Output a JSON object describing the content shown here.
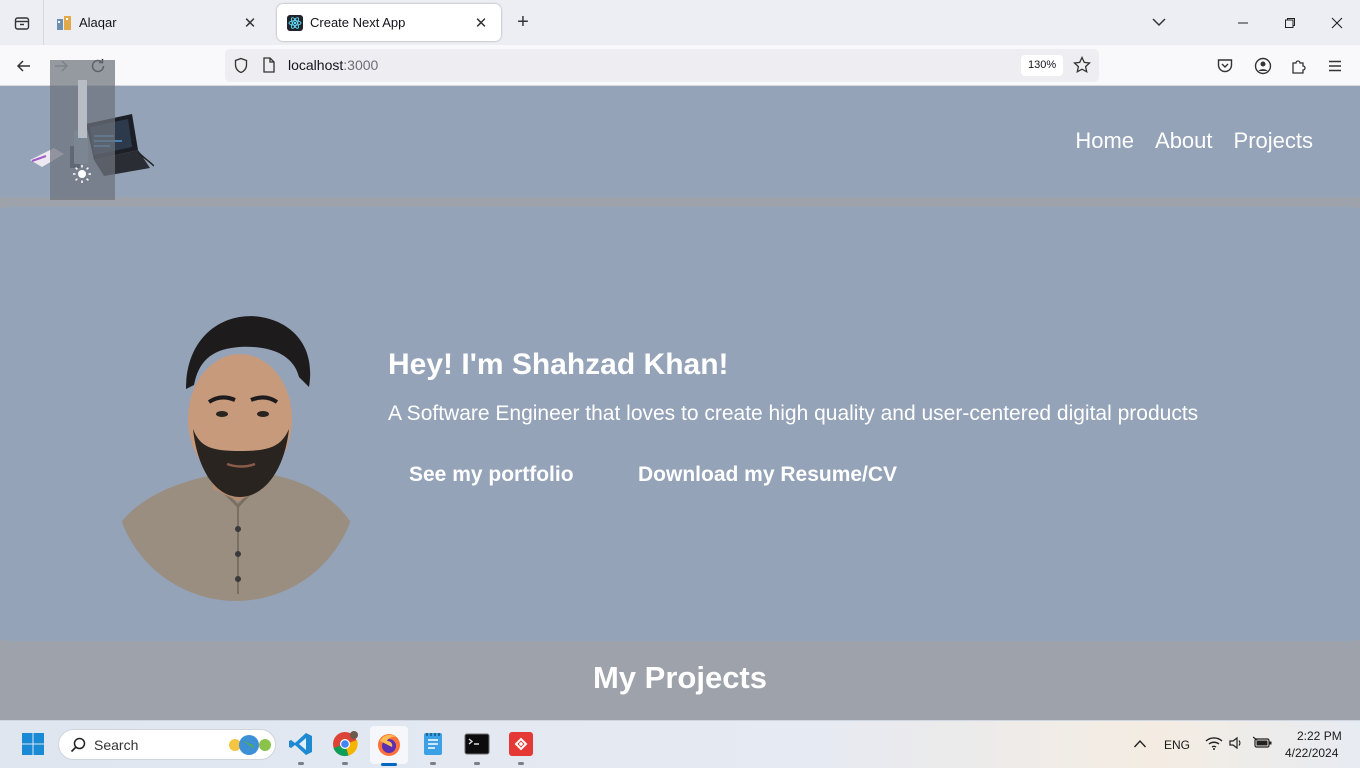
{
  "browser": {
    "tabs": [
      {
        "title": "Alaqar",
        "active": false
      },
      {
        "title": "Create Next App",
        "active": true
      }
    ],
    "url": {
      "host": "localhost",
      "port": ":3000"
    },
    "zoom": "130%"
  },
  "site": {
    "nav": [
      "Home",
      "About",
      "Projects"
    ],
    "hero": {
      "title": "Hey! I'm Shahzad Khan!",
      "subtitle": "A Software Engineer that loves to create high quality and user-centered digital products",
      "buttons": [
        "See my portfolio",
        "Download my Resume/CV"
      ]
    },
    "projects_heading": "My Projects"
  },
  "taskbar": {
    "search_label": "Search",
    "language": "ENG",
    "time": "2:22 PM",
    "date": "4/22/2024"
  },
  "colors": {
    "page_bg": "#9ea2aa",
    "hero_bg": "#94a3b8",
    "text": "#ffffff"
  }
}
